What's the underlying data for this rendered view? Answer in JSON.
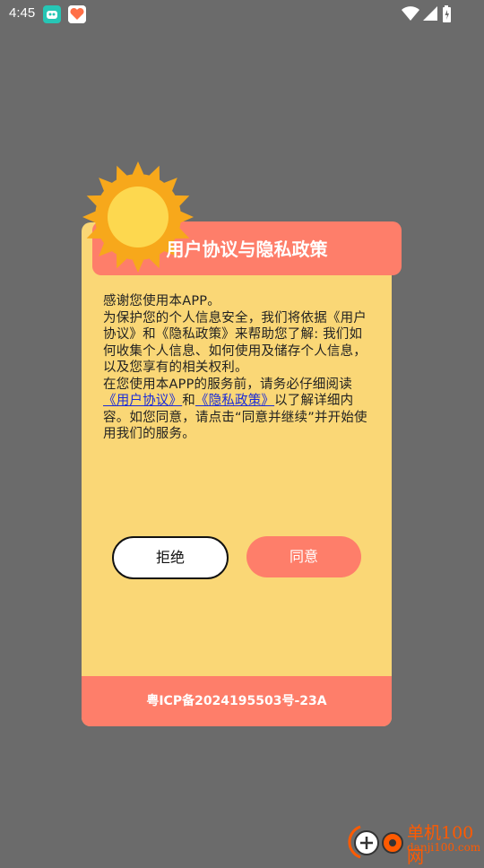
{
  "status_bar": {
    "time": "4:45"
  },
  "dialog": {
    "title": "用户协议与隐私政策",
    "line1": "感谢您使用本APP。",
    "line2": "为保护您的个人信息安全，我们将依据《用户协议》和《隐私政策》来帮助您了解: 我们如何收集个人信息、如何使用及储存个人信息，以及您享有的相关权利。",
    "line3_prefix": "在您使用本APP的服务前，请务必仔细阅读",
    "link_user_agreement": "《用户协议》",
    "conjunction": "和",
    "link_privacy_policy": "《隐私政策》",
    "line3_suffix": "以了解详细内容。如您同意，请点击“同意并继续”并开始使用我们的服务。",
    "reject_label": "拒绝",
    "agree_label": "同意",
    "footer_icp": "粤ICP备2024195503号-23A"
  },
  "watermark": {
    "name": "单机100网",
    "url": "danji100.com"
  },
  "colors": {
    "background": "#6b6b6b",
    "dialog": "#fad776",
    "accent": "#fe7e6a",
    "link": "#1a2bd8"
  }
}
